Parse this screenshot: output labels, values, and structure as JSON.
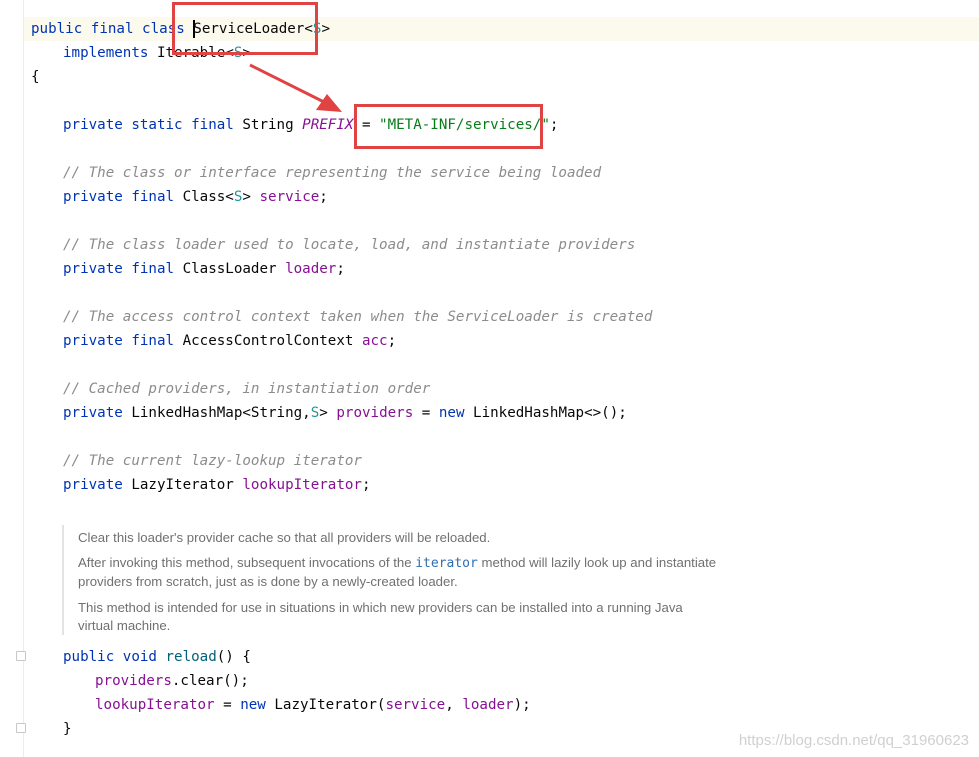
{
  "editor": {
    "language": "Java",
    "lines": {
      "l1_kw": "public final class ",
      "l1_class": "ServiceLoader",
      "l1_lt": "<",
      "l1_tp": "S",
      "l1_gt": ">",
      "l2_kw": "implements ",
      "l2_iface": "Iterable",
      "l2_lt": "<",
      "l2_tp": "S",
      "l2_gt": ">",
      "l3": "{",
      "l5_kw": "private static final ",
      "l5_type": "String ",
      "l5_const": "PREFIX",
      "l5_eq": " = ",
      "l5_str": "\"META-INF/services/\"",
      "l5_semi": ";",
      "l7_comment": "// The class or interface representing the service being loaded",
      "l8_kw": "private final ",
      "l8_type": "Class<",
      "l8_tp": "S",
      "l8_gt": "> ",
      "l8_field": "service",
      "l8_semi": ";",
      "l10_comment": "// The class loader used to locate, load, and instantiate providers",
      "l11_kw": "private final ",
      "l11_type": "ClassLoader ",
      "l11_field": "loader",
      "l11_semi": ";",
      "l13_comment": "// The access control context taken when the ServiceLoader is created",
      "l14_kw": "private final ",
      "l14_type": "AccessControlContext ",
      "l14_field": "acc",
      "l14_semi": ";",
      "l16_comment": "// Cached providers, in instantiation order",
      "l17_kw": "private ",
      "l17_type": "LinkedHashMap<String,",
      "l17_tp": "S",
      "l17_gt": "> ",
      "l17_field": "providers",
      "l17_eq": " = ",
      "l17_new": "new ",
      "l17_ctor": "LinkedHashMap<>();",
      "l19_comment": "// The current lazy-lookup iterator",
      "l20_kw": "private ",
      "l20_type": "LazyIterator ",
      "l20_field": "lookupIterator",
      "l20_semi": ";",
      "m1_kw": "public void ",
      "m1_name": "reload",
      "m1_rest": "() {",
      "m2_field": "providers",
      "m2_rest": ".clear();",
      "m3_field": "lookupIterator",
      "m3_eq": " = ",
      "m3_new": "new ",
      "m3_type": "LazyIterator(",
      "m3_arg1": "service",
      "m3_comma": ", ",
      "m3_arg2": "loader",
      "m3_end": ");",
      "m4": "}"
    },
    "doc": {
      "p1": "Clear this loader's provider cache so that all providers will be reloaded.",
      "p2_a": "After invoking this method, subsequent invocations of the ",
      "p2_code": "iterator",
      "p2_b": " method will lazily look up and instantiate providers from scratch, just as is done by a newly-created loader.",
      "p3": "This method is intended for use in situations in which new providers can be installed into a running Java virtual machine."
    },
    "annotation_color": "#e04343"
  },
  "watermark": "https://blog.csdn.net/qq_31960623"
}
